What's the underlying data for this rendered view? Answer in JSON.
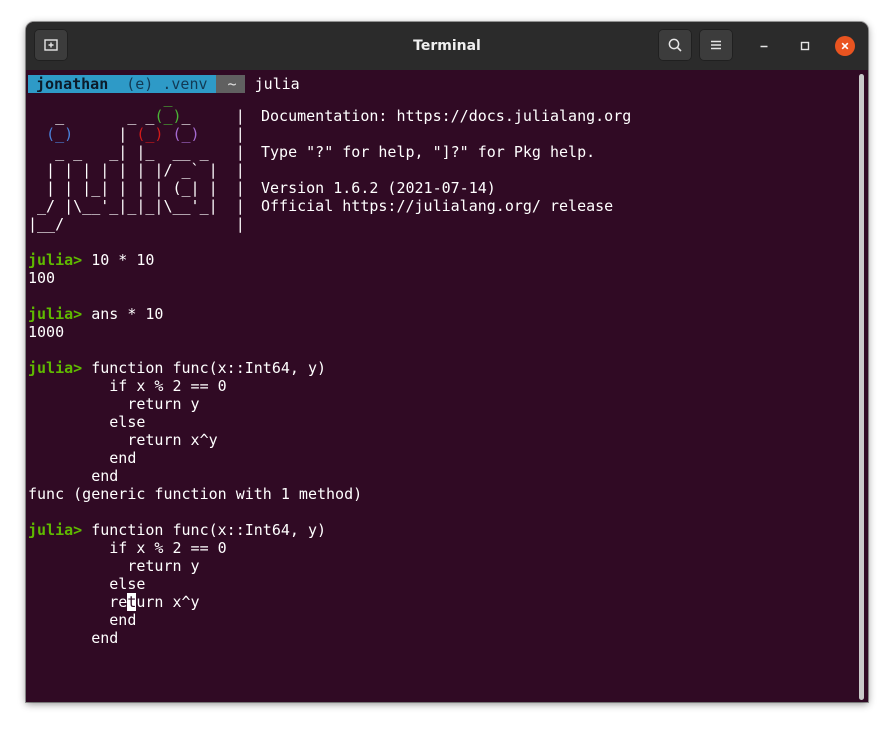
{
  "window": {
    "title": "Terminal"
  },
  "prompt_bar": {
    "user": "jonathan",
    "venv": "(e) .venv",
    "dir": "~",
    "command": "julia"
  },
  "banner": {
    "logo": [
      "               _",
      "   _       _ _(_)_     |",
      "  (_)     | (_) (_)    |",
      "   _ _   _| |_  __ _   |",
      "  | | | | | | |/ _` |  |",
      "  | | |_| | | | (_| |  |",
      " _/ |\\__'_|_|_|\\__'_|  |",
      "|__/                   |"
    ],
    "info": [
      "",
      "Documentation: https://docs.julialang.org",
      "",
      "Type \"?\" for help, \"]?\" for Pkg help.",
      "",
      "Version 1.6.2 (2021-07-14)",
      "Official https://julialang.org/ release",
      ""
    ]
  },
  "session": {
    "prompt": "julia>",
    "cmd1": " 10 * 10",
    "out1": "100",
    "cmd2": " ans * 10",
    "out2": "1000",
    "func1": [
      " function func(x::Int64, y)",
      "         if x % 2 == 0",
      "           return y",
      "         else",
      "           return x^y",
      "         end",
      "       end"
    ],
    "out3": "func (generic function with 1 method)",
    "func2": [
      " function func(x::Int64, y)",
      "         if x % 2 == 0",
      "           return y",
      "         else"
    ],
    "edit_line": {
      "before": "         re",
      "cursor": "t",
      "after": "urn x^y"
    },
    "func2_tail": [
      "         end",
      "       end"
    ]
  },
  "colors": {
    "background": "#300a24",
    "prompt": "#5fb900",
    "close": "#e95420"
  },
  "icons": [
    "new-tab-icon",
    "search-icon",
    "hamburger-menu-icon",
    "minimize-icon",
    "maximize-icon",
    "close-icon"
  ]
}
